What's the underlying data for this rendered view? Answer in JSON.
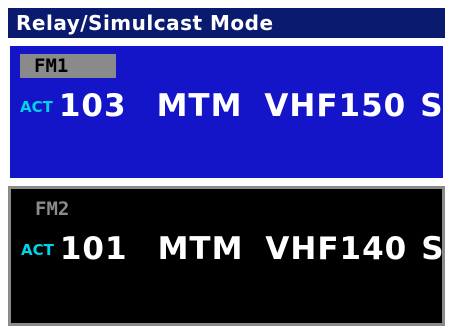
{
  "title": "Relay/Simulcast Mode",
  "colors": {
    "title_bg": "#0a1a6e",
    "fm1_bg": "#1414c8",
    "fm2_bg": "#000000",
    "act_text": "#00d4e8",
    "tag_gray": "#8a8a8a"
  },
  "fm1": {
    "tag": "FM1",
    "status": "ACT",
    "channel": "103",
    "mode": "MTM",
    "rf": "VHF150",
    "suffix": "S"
  },
  "fm2": {
    "tag": "FM2",
    "status": "ACT",
    "channel": "101",
    "mode": "MTM",
    "rf": "VHF140",
    "suffix": "S"
  }
}
